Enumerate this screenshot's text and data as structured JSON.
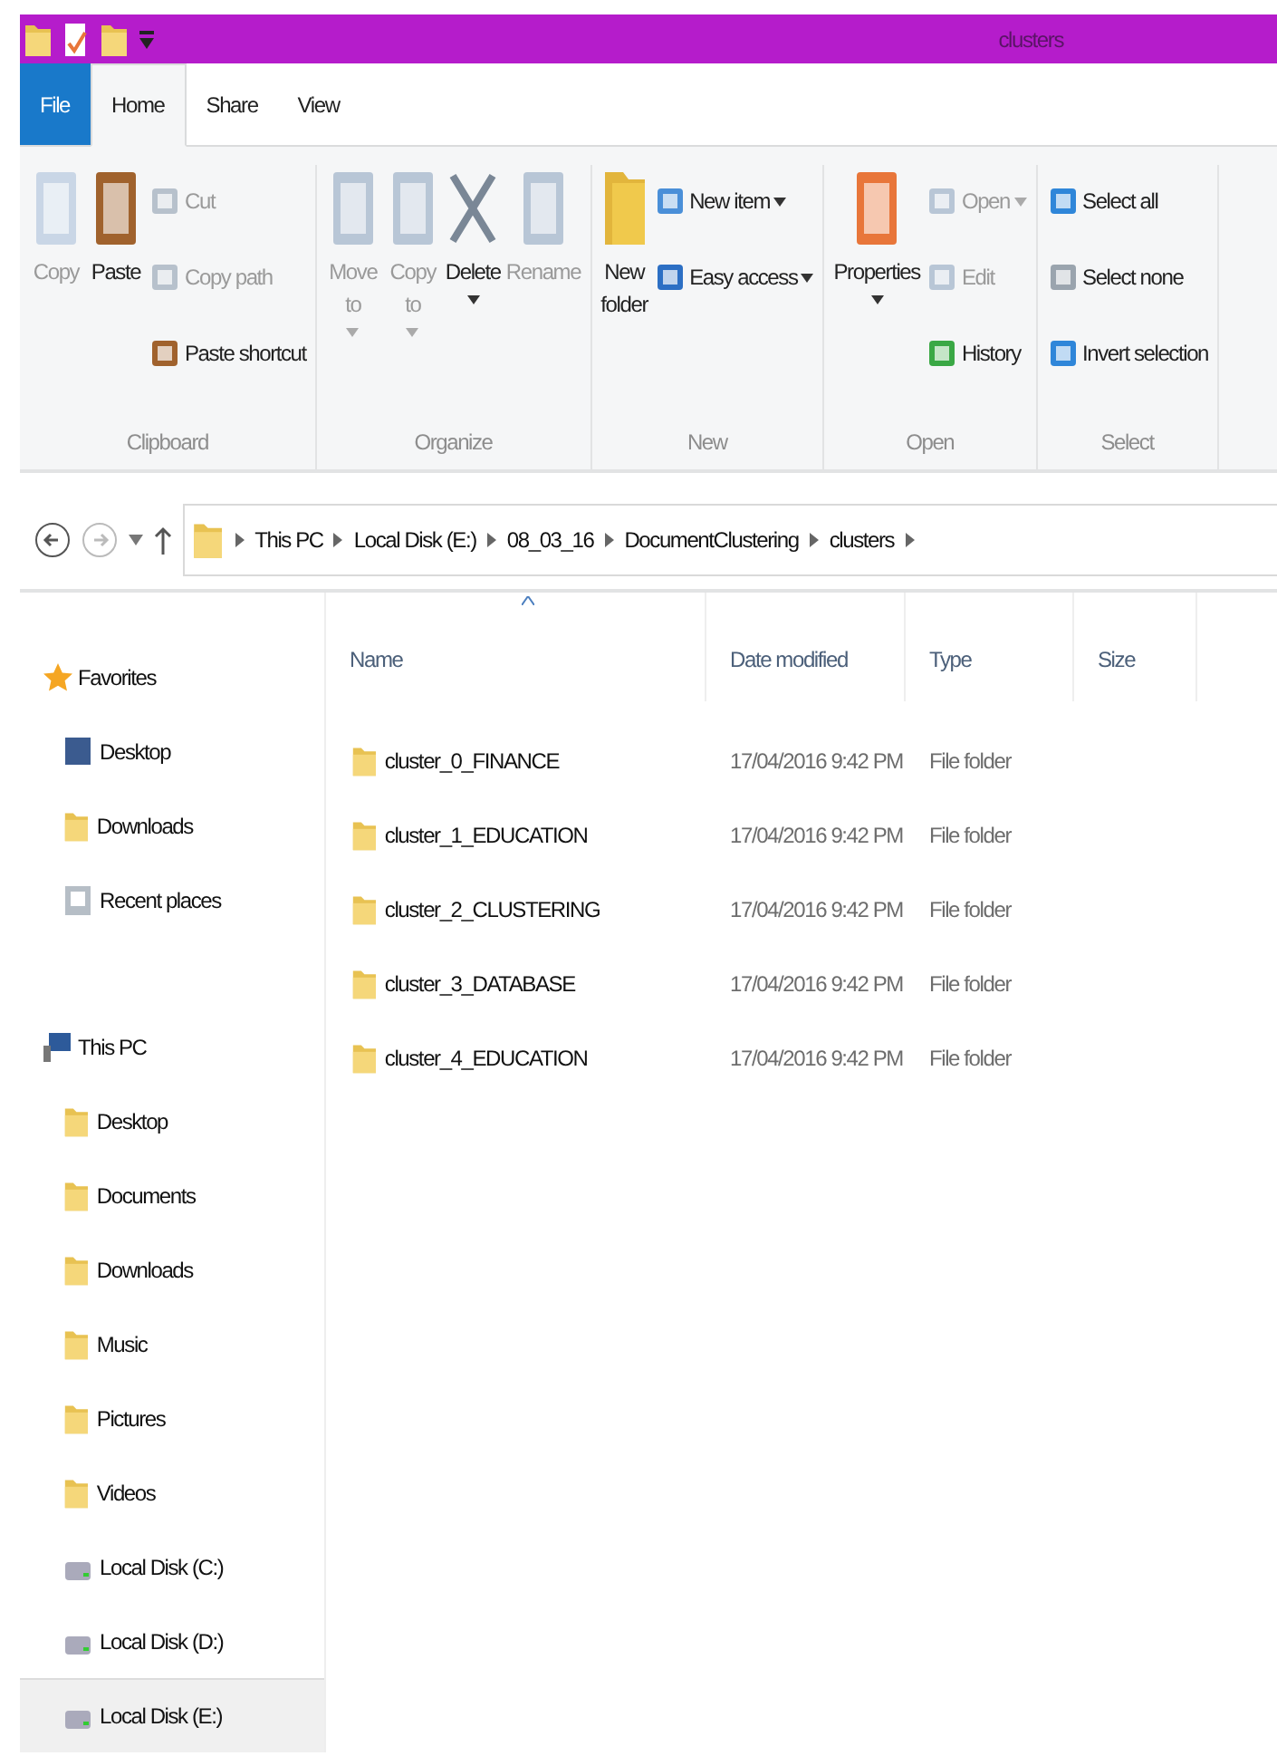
{
  "window": {
    "title": "clusters"
  },
  "tabs": [
    {
      "label": "File",
      "selected": false,
      "kind": "file"
    },
    {
      "label": "Home",
      "selected": true,
      "kind": "tab"
    },
    {
      "label": "Share",
      "selected": false,
      "kind": "tab"
    },
    {
      "label": "View",
      "selected": false,
      "kind": "tab"
    }
  ],
  "ribbon": [
    {
      "label": "Clipboard",
      "items": [
        {
          "label": "Copy",
          "kind": "large",
          "disabled": true,
          "dropdown": false
        },
        {
          "label": "Paste",
          "kind": "large",
          "disabled": false,
          "dropdown": false
        },
        {
          "label": "Cut",
          "kind": "small",
          "disabled": true,
          "dropdown": false
        },
        {
          "label": "Copy path",
          "kind": "small",
          "disabled": true,
          "dropdown": false
        },
        {
          "label": "Paste shortcut",
          "kind": "small",
          "disabled": false,
          "dropdown": false
        }
      ]
    },
    {
      "label": "Organize",
      "items": [
        {
          "label": "Move to",
          "kind": "large",
          "disabled": true,
          "dropdown": true
        },
        {
          "label": "Copy to",
          "kind": "large",
          "disabled": true,
          "dropdown": true
        },
        {
          "label": "Delete",
          "kind": "large",
          "disabled": false,
          "dropdown": true
        },
        {
          "label": "Rename",
          "kind": "large",
          "disabled": true,
          "dropdown": false
        }
      ]
    },
    {
      "label": "New",
      "items": [
        {
          "label": "New folder",
          "kind": "large",
          "disabled": false,
          "dropdown": false
        },
        {
          "label": "New item",
          "kind": "small",
          "disabled": false,
          "dropdown": true
        },
        {
          "label": "Easy access",
          "kind": "small",
          "disabled": false,
          "dropdown": true
        }
      ]
    },
    {
      "label": "Open",
      "items": [
        {
          "label": "Properties",
          "kind": "large",
          "disabled": false,
          "dropdown": true
        },
        {
          "label": "Open",
          "kind": "small",
          "disabled": true,
          "dropdown": true
        },
        {
          "label": "Edit",
          "kind": "small",
          "disabled": true,
          "dropdown": false
        },
        {
          "label": "History",
          "kind": "small",
          "disabled": false,
          "dropdown": false
        }
      ]
    },
    {
      "label": "Select",
      "items": [
        {
          "label": "Select all",
          "kind": "small",
          "disabled": false,
          "dropdown": false
        },
        {
          "label": "Select none",
          "kind": "small",
          "disabled": false,
          "dropdown": false
        },
        {
          "label": "Invert selection",
          "kind": "small",
          "disabled": false,
          "dropdown": false
        }
      ]
    }
  ],
  "address": {
    "segments": [
      "This PC",
      "Local Disk (E:)",
      "08_03_16",
      "DocumentClustering",
      "clusters"
    ]
  },
  "sidebar": [
    {
      "label": "Favorites",
      "items": [
        {
          "label": "Desktop",
          "selected": false
        },
        {
          "label": "Downloads",
          "selected": false
        },
        {
          "label": "Recent places",
          "selected": false
        }
      ]
    },
    {
      "label": "This PC",
      "items": [
        {
          "label": "Desktop",
          "selected": false
        },
        {
          "label": "Documents",
          "selected": false
        },
        {
          "label": "Downloads",
          "selected": false
        },
        {
          "label": "Music",
          "selected": false
        },
        {
          "label": "Pictures",
          "selected": false
        },
        {
          "label": "Videos",
          "selected": false
        },
        {
          "label": "Local Disk (C:)",
          "selected": false
        },
        {
          "label": "Local Disk (D:)",
          "selected": false
        },
        {
          "label": "Local Disk (E:)",
          "selected": true
        }
      ]
    }
  ],
  "columns": [
    "Name",
    "Date modified",
    "Type",
    "Size"
  ],
  "files": [
    {
      "name": "cluster_0_FINANCE",
      "date": "17/04/2016 9:42 PM",
      "type": "File folder"
    },
    {
      "name": "cluster_1_EDUCATION",
      "date": "17/04/2016 9:42 PM",
      "type": "File folder"
    },
    {
      "name": "cluster_2_CLUSTERING",
      "date": "17/04/2016 9:42 PM",
      "type": "File folder"
    },
    {
      "name": "cluster_3_DATABASE",
      "date": "17/04/2016 9:42 PM",
      "type": "File folder"
    },
    {
      "name": "cluster_4_EDUCATION",
      "date": "17/04/2016 9:42 PM",
      "type": "File folder"
    }
  ]
}
